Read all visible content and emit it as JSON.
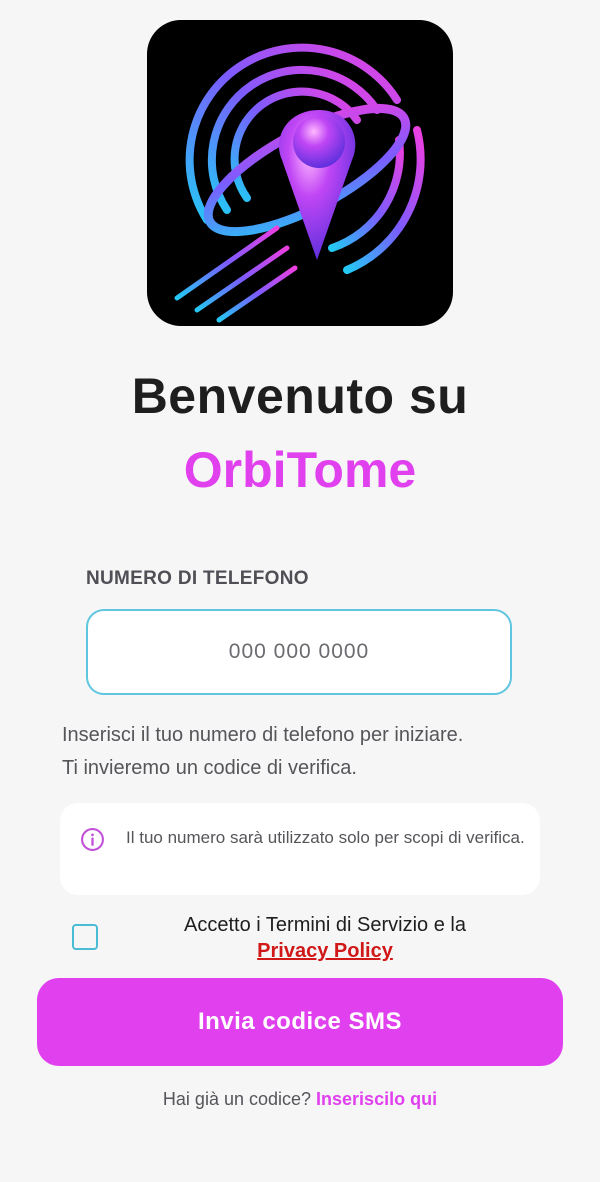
{
  "logo": {
    "icon": "orbit-location-pin-logo"
  },
  "header": {
    "welcome": "Benvenuto su",
    "brand": "OrbiTome"
  },
  "form": {
    "phone_label": "NUMERO DI TELEFONO",
    "phone_placeholder": "000 000 0000",
    "phone_value": "",
    "helper_line1": "Inserisci il tuo numero di telefono per iniziare.",
    "helper_line2": "Ti invieremo un codice di verifica."
  },
  "info": {
    "icon": "info-circle-icon",
    "text": "Il tuo numero sarà utilizzato solo per scopi di verifica."
  },
  "terms": {
    "checked": false,
    "line1": "Accetto i Termini di Servizio e la",
    "link": "Privacy Policy"
  },
  "submit": {
    "label": "Invia codice SMS"
  },
  "footer": {
    "question": "Hai già un codice? ",
    "link": "Inseriscilo qui"
  },
  "colors": {
    "brand_magenta": "#e040ee",
    "input_border": "#5fc6e0",
    "link_red": "#d01818",
    "background": "#f6f6f7"
  }
}
